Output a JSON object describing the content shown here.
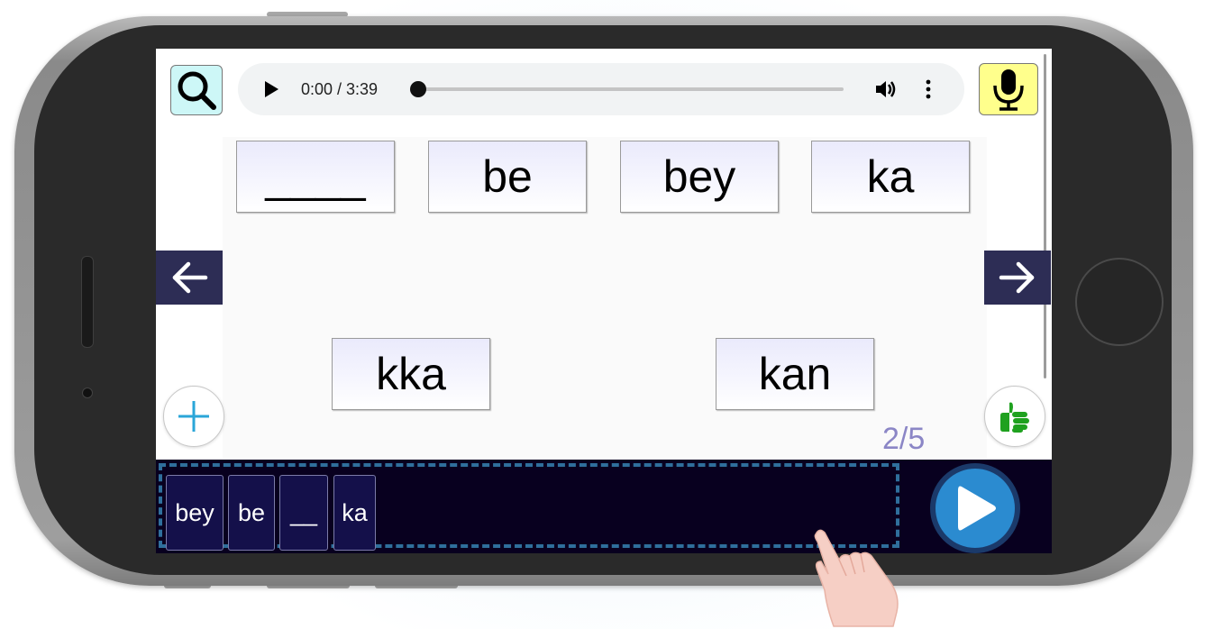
{
  "audio": {
    "time": "0:00 / 3:39",
    "progress": 0
  },
  "word_tiles": [
    "____",
    "be",
    "bey",
    "ka",
    "kka",
    "kan"
  ],
  "counter": "2/5",
  "answer_chips": [
    "bey",
    "be",
    "__",
    "ka"
  ],
  "colors": {
    "search_bg": "#cdf7f7",
    "mic_bg": "#ffff8c",
    "nav_bg": "#2d2d55",
    "bottom_bar": "#08001f",
    "dropzone_border": "#2f6f9c",
    "play_button": "#2b8bd0",
    "counter": "#8b86c6",
    "thumbs_up": "#1fa11f",
    "plus": "#2aa6d8"
  },
  "icons": {
    "search": "search-icon",
    "mic": "microphone-icon",
    "prev": "arrow-left-icon",
    "next": "arrow-right-icon",
    "add": "plus-icon",
    "like": "thumbs-up-icon",
    "play": "play-icon",
    "volume": "volume-icon",
    "menu": "more-vertical-icon"
  }
}
